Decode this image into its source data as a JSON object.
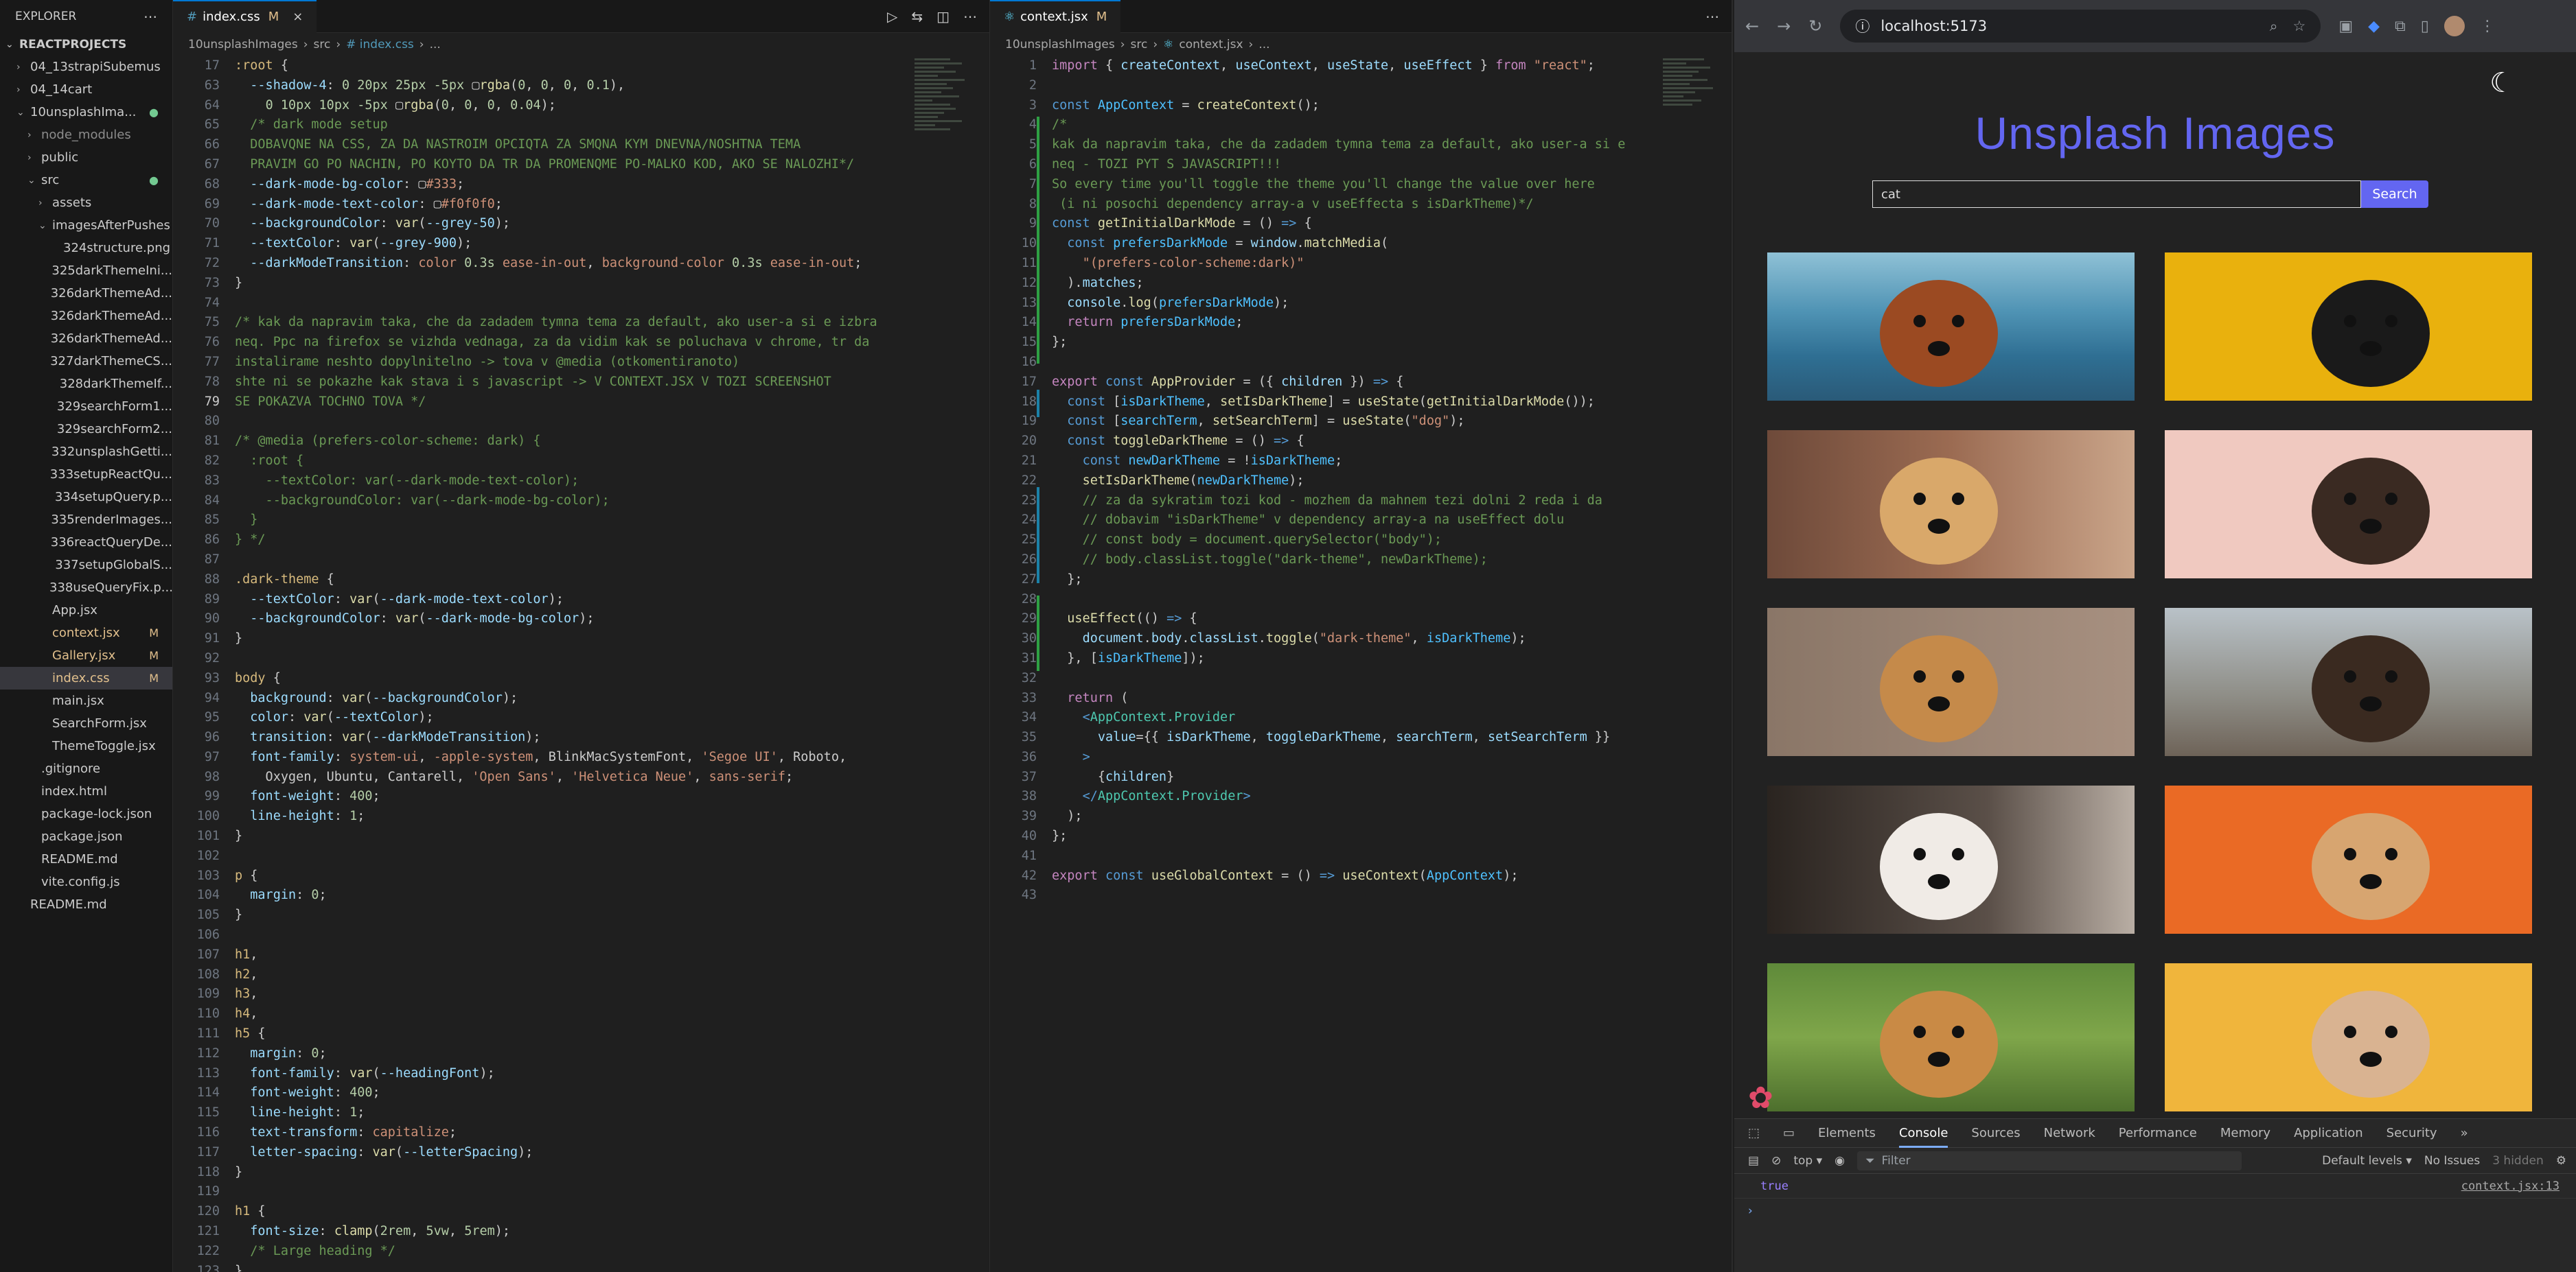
{
  "explorer": {
    "title": "EXPLORER",
    "project": "REACTPROJECTS",
    "items": [
      {
        "label": "04_13strapiSubemus",
        "indent": 1,
        "twisty": "›"
      },
      {
        "label": "04_14cart",
        "indent": 1,
        "twisty": "›"
      },
      {
        "label": "10unsplashIma...",
        "indent": 1,
        "twisty": "⌄",
        "badge": "●"
      },
      {
        "label": "node_modules",
        "indent": 2,
        "twisty": "›",
        "dim": true
      },
      {
        "label": "public",
        "indent": 2,
        "twisty": "›"
      },
      {
        "label": "src",
        "indent": 2,
        "twisty": "⌄",
        "badge": "●"
      },
      {
        "label": "assets",
        "indent": 3,
        "twisty": "›"
      },
      {
        "label": "imagesAfterPushes",
        "indent": 3,
        "twisty": "⌄"
      },
      {
        "label": "324structure.png",
        "indent": 4
      },
      {
        "label": "325darkThemeIni...",
        "indent": 4
      },
      {
        "label": "326darkThemeAd...",
        "indent": 4
      },
      {
        "label": "326darkThemeAd...",
        "indent": 4
      },
      {
        "label": "326darkThemeAd...",
        "indent": 4
      },
      {
        "label": "327darkThemeCS...",
        "indent": 4
      },
      {
        "label": "328darkThemeIf...",
        "indent": 4
      },
      {
        "label": "329searchForm1...",
        "indent": 4
      },
      {
        "label": "329searchForm2...",
        "indent": 4
      },
      {
        "label": "332unsplashGetti...",
        "indent": 4
      },
      {
        "label": "333setupReactQu...",
        "indent": 4
      },
      {
        "label": "334setupQuery.p...",
        "indent": 4
      },
      {
        "label": "335renderImages...",
        "indent": 4
      },
      {
        "label": "336reactQueryDe...",
        "indent": 4
      },
      {
        "label": "337setupGlobalS...",
        "indent": 4
      },
      {
        "label": "338useQueryFix.p...",
        "indent": 4
      },
      {
        "label": "App.jsx",
        "indent": 3
      },
      {
        "label": "context.jsx",
        "indent": 3,
        "badge": "M"
      },
      {
        "label": "Gallery.jsx",
        "indent": 3,
        "badge": "M"
      },
      {
        "label": "index.css",
        "indent": 3,
        "badge": "M",
        "active": true
      },
      {
        "label": "main.jsx",
        "indent": 3
      },
      {
        "label": "SearchForm.jsx",
        "indent": 3
      },
      {
        "label": "ThemeToggle.jsx",
        "indent": 3
      },
      {
        "label": ".gitignore",
        "indent": 2
      },
      {
        "label": "index.html",
        "indent": 2
      },
      {
        "label": "package-lock.json",
        "indent": 2
      },
      {
        "label": "package.json",
        "indent": 2
      },
      {
        "label": "README.md",
        "indent": 2
      },
      {
        "label": "vite.config.js",
        "indent": 2
      },
      {
        "label": "README.md",
        "indent": 1
      }
    ]
  },
  "editor1": {
    "tab": "index.css",
    "tab_status": "M",
    "crumbs": [
      "10unsplashImages",
      "src",
      "# index.css",
      "..."
    ],
    "current_line": 79,
    "lines": [
      {
        "n": 17,
        "h": "<span class='sel'>:root</span> {"
      },
      {
        "n": 63,
        "h": "  <span class='v'>--shadow-4</span>: <span class='n'>0</span> <span class='n'>20px</span> <span class='n'>25px</span> <span class='n'>-5px</span> ▢<span class='f'>rgba</span>(<span class='n'>0</span>, <span class='n'>0</span>, <span class='n'>0</span>, <span class='n'>0.1</span>),"
      },
      {
        "n": 64,
        "h": "    <span class='n'>0</span> <span class='n'>10px</span> <span class='n'>10px</span> <span class='n'>-5px</span> ▢<span class='f'>rgba</span>(<span class='n'>0</span>, <span class='n'>0</span>, <span class='n'>0</span>, <span class='n'>0.04</span>);"
      },
      {
        "n": 65,
        "h": "  <span class='c'>/* dark mode setup</span>"
      },
      {
        "n": 66,
        "h": "<span class='c'>  DOBAVQNE NA CSS, ZA DA NASTROIM OPCIQTA ZA SMQNA KYM DNEVNA/NOSHTNA TEMA</span>"
      },
      {
        "n": 67,
        "h": "<span class='c'>  PRAVIM GO PO NACHIN, PO KOYTO DA TR DA PROMENQME PO-MALKO KOD, AKO SE NALOZHI*/</span>"
      },
      {
        "n": 68,
        "h": "  <span class='v'>--dark-mode-bg-color</span>: ▢<span class='s'>#333</span>;"
      },
      {
        "n": 69,
        "h": "  <span class='v'>--dark-mode-text-color</span>: ▢<span class='s'>#f0f0f0</span>;"
      },
      {
        "n": 70,
        "h": "  <span class='v'>--backgroundColor</span>: <span class='f'>var</span>(<span class='v'>--grey-50</span>);"
      },
      {
        "n": 71,
        "h": "  <span class='v'>--textColor</span>: <span class='f'>var</span>(<span class='v'>--grey-900</span>);"
      },
      {
        "n": 72,
        "h": "  <span class='v'>--darkModeTransition</span>: <span class='s'>color</span> <span class='n'>0.3s</span> <span class='s'>ease-in-out</span>, <span class='s'>background-color</span> <span class='n'>0.3s</span> <span class='s'>ease-in-out</span>;"
      },
      {
        "n": 73,
        "h": "}"
      },
      {
        "n": 74,
        "h": ""
      },
      {
        "n": 75,
        "h": "<span class='c'>/* kak da napravim taka, che da zadadem tymna tema za default, ako user-a si e izbra</span>"
      },
      {
        "n": 76,
        "h": "<span class='c'>neq. Ppc na firefox se vizhda vednaga, za da vidim kak se poluchava v chrome, tr da</span>"
      },
      {
        "n": 77,
        "h": "<span class='c'>instalirame neshto dopylnitelno -> tova v @media (otkomentiranoto)</span>"
      },
      {
        "n": 78,
        "h": "<span class='c'>shte ni se pokazhe kak stava i s javascript -> V CONTEXT.JSX V TOZI SCREENSHOT</span>"
      },
      {
        "n": 79,
        "h": "<span class='c'>SE POKAZVA TOCHNO TOVA */</span>"
      },
      {
        "n": 80,
        "h": ""
      },
      {
        "n": 81,
        "h": "<span class='c'>/* @media (prefers-color-scheme: dark) {</span>"
      },
      {
        "n": 82,
        "h": "<span class='c'>  :root {</span>"
      },
      {
        "n": 83,
        "h": "<span class='c'>    --textColor: var(--dark-mode-text-color);</span>"
      },
      {
        "n": 84,
        "h": "<span class='c'>    --backgroundColor: var(--dark-mode-bg-color);</span>"
      },
      {
        "n": 85,
        "h": "<span class='c'>  }</span>"
      },
      {
        "n": 86,
        "h": "<span class='c'>} */</span>"
      },
      {
        "n": 87,
        "h": ""
      },
      {
        "n": 88,
        "h": "<span class='sel'>.dark-theme</span> {"
      },
      {
        "n": 89,
        "h": "  <span class='v'>--textColor</span>: <span class='f'>var</span>(<span class='v'>--dark-mode-text-color</span>);"
      },
      {
        "n": 90,
        "h": "  <span class='v'>--backgroundColor</span>: <span class='f'>var</span>(<span class='v'>--dark-mode-bg-color</span>);"
      },
      {
        "n": 91,
        "h": "}"
      },
      {
        "n": 92,
        "h": ""
      },
      {
        "n": 93,
        "h": "<span class='sel'>body</span> {"
      },
      {
        "n": 94,
        "h": "  <span class='v'>background</span>: <span class='f'>var</span>(<span class='v'>--backgroundColor</span>);"
      },
      {
        "n": 95,
        "h": "  <span class='v'>color</span>: <span class='f'>var</span>(<span class='v'>--textColor</span>);"
      },
      {
        "n": 96,
        "h": "  <span class='v'>transition</span>: <span class='f'>var</span>(<span class='v'>--darkModeTransition</span>);"
      },
      {
        "n": 97,
        "h": "  <span class='v'>font-family</span>: <span class='s'>system-ui</span>, <span class='s'>-apple-system</span>, BlinkMacSystemFont, <span class='s'>'Segoe UI'</span>, Roboto,"
      },
      {
        "n": 98,
        "h": "    Oxygen, Ubuntu, Cantarell, <span class='s'>'Open Sans'</span>, <span class='s'>'Helvetica Neue'</span>, <span class='s'>sans-serif</span>;"
      },
      {
        "n": 99,
        "h": "  <span class='v'>font-weight</span>: <span class='n'>400</span>;"
      },
      {
        "n": 100,
        "h": "  <span class='v'>line-height</span>: <span class='n'>1</span>;"
      },
      {
        "n": 101,
        "h": "}"
      },
      {
        "n": 102,
        "h": ""
      },
      {
        "n": 103,
        "h": "<span class='sel'>p</span> {"
      },
      {
        "n": 104,
        "h": "  <span class='v'>margin</span>: <span class='n'>0</span>;"
      },
      {
        "n": 105,
        "h": "}"
      },
      {
        "n": 106,
        "h": ""
      },
      {
        "n": 107,
        "h": "<span class='sel'>h1</span>,"
      },
      {
        "n": 108,
        "h": "<span class='sel'>h2</span>,"
      },
      {
        "n": 109,
        "h": "<span class='sel'>h3</span>,"
      },
      {
        "n": 110,
        "h": "<span class='sel'>h4</span>,"
      },
      {
        "n": 111,
        "h": "<span class='sel'>h5</span> {"
      },
      {
        "n": 112,
        "h": "  <span class='v'>margin</span>: <span class='n'>0</span>;"
      },
      {
        "n": 113,
        "h": "  <span class='v'>font-family</span>: <span class='f'>var</span>(<span class='v'>--headingFont</span>);"
      },
      {
        "n": 114,
        "h": "  <span class='v'>font-weight</span>: <span class='n'>400</span>;"
      },
      {
        "n": 115,
        "h": "  <span class='v'>line-height</span>: <span class='n'>1</span>;"
      },
      {
        "n": 116,
        "h": "  <span class='v'>text-transform</span>: <span class='s'>capitalize</span>;"
      },
      {
        "n": 117,
        "h": "  <span class='v'>letter-spacing</span>: <span class='f'>var</span>(<span class='v'>--letterSpacing</span>);"
      },
      {
        "n": 118,
        "h": "}"
      },
      {
        "n": 119,
        "h": ""
      },
      {
        "n": 120,
        "h": "<span class='sel'>h1</span> {"
      },
      {
        "n": 121,
        "h": "  <span class='v'>font-size</span>: <span class='f'>clamp</span>(<span class='n'>2rem</span>, <span class='n'>5vw</span>, <span class='n'>5rem</span>);"
      },
      {
        "n": 122,
        "h": "  <span class='c'>/* Large heading */</span>"
      },
      {
        "n": 123,
        "h": "}"
      }
    ]
  },
  "editor2": {
    "tab": "context.jsx",
    "tab_status": "M",
    "crumbs": [
      "10unsplashImages",
      "src",
      "context.jsx",
      "..."
    ],
    "lines": [
      {
        "n": 1,
        "h": "<span class='k'>import</span> { <span class='v'>createContext</span>, <span class='v'>useContext</span>, <span class='v'>useState</span>, <span class='v'>useEffect</span> } <span class='k'>from</span> <span class='s'>\"react\"</span>;"
      },
      {
        "n": 2,
        "h": ""
      },
      {
        "n": 3,
        "h": "<span class='b'>const</span> <span class='cst'>AppContext</span> = <span class='f'>createContext</span>();"
      },
      {
        "n": 4,
        "h": "<span class='c'>/*</span>"
      },
      {
        "n": 5,
        "h": "<span class='c'>kak da napravim taka, che da zadadem tymna tema za default, ako user-a si e</span>"
      },
      {
        "n": 6,
        "h": "<span class='c'>neq - TOZI PYT S JAVASCRIPT!!!</span>"
      },
      {
        "n": 7,
        "h": "<span class='c'>So every time you'll toggle the theme you'll change the value over here</span>"
      },
      {
        "n": 8,
        "h": "<span class='c'> (i ni posochi dependency array-a v useEffecta s isDarkTheme)*/</span>"
      },
      {
        "n": 9,
        "h": "<span class='b'>const</span> <span class='f'>getInitialDarkMode</span> = () <span class='b'>=&gt;</span> {"
      },
      {
        "n": 10,
        "h": "  <span class='b'>const</span> <span class='cst'>prefersDarkMode</span> = <span class='v'>window</span>.<span class='f'>matchMedia</span>("
      },
      {
        "n": 11,
        "h": "    <span class='s'>\"(prefers-color-scheme:dark)\"</span>"
      },
      {
        "n": 12,
        "h": "  ).<span class='v'>matches</span>;"
      },
      {
        "n": 13,
        "h": "  <span class='v'>console</span>.<span class='f'>log</span>(<span class='cst'>prefersDarkMode</span>);"
      },
      {
        "n": 14,
        "h": "  <span class='k'>return</span> <span class='cst'>prefersDarkMode</span>;"
      },
      {
        "n": 15,
        "h": "};"
      },
      {
        "n": 16,
        "h": ""
      },
      {
        "n": 17,
        "h": "<span class='k'>export</span> <span class='b'>const</span> <span class='f'>AppProvider</span> = ({ <span class='v'>children</span> }) <span class='b'>=&gt;</span> {"
      },
      {
        "n": 18,
        "h": "  <span class='b'>const</span> [<span class='cst'>isDarkTheme</span>, <span class='f'>setIsDarkTheme</span>] = <span class='f'>useState</span>(<span class='f'>getInitialDarkMode</span>());"
      },
      {
        "n": 19,
        "h": "  <span class='b'>const</span> [<span class='cst'>searchTerm</span>, <span class='f'>setSearchTerm</span>] = <span class='f'>useState</span>(<span class='s'>\"dog\"</span>);"
      },
      {
        "n": 20,
        "h": "  <span class='b'>const</span> <span class='f'>toggleDarkTheme</span> = () <span class='b'>=&gt;</span> {"
      },
      {
        "n": 21,
        "h": "    <span class='b'>const</span> <span class='cst'>newDarkTheme</span> = !<span class='cst'>isDarkTheme</span>;"
      },
      {
        "n": 22,
        "h": "    <span class='f'>setIsDarkTheme</span>(<span class='cst'>newDarkTheme</span>);"
      },
      {
        "n": 23,
        "h": "    <span class='c'>// za da sykratim tozi kod - mozhem da mahnem tezi dolni 2 reda i da</span>"
      },
      {
        "n": 24,
        "h": "    <span class='c'>// dobavim \"isDarkTheme\" v dependency array-a na useEffect dolu</span>"
      },
      {
        "n": 25,
        "h": "    <span class='c'>// const body = document.querySelector(\"body\");</span>"
      },
      {
        "n": 26,
        "h": "    <span class='c'>// body.classList.toggle(\"dark-theme\", newDarkTheme);</span>"
      },
      {
        "n": 27,
        "h": "  };"
      },
      {
        "n": 28,
        "h": ""
      },
      {
        "n": 29,
        "h": "  <span class='f'>useEffect</span>(() <span class='b'>=&gt;</span> {"
      },
      {
        "n": 30,
        "h": "    <span class='v'>document</span>.<span class='v'>body</span>.<span class='v'>classList</span>.<span class='f'>toggle</span>(<span class='s'>\"dark-theme\"</span>, <span class='cst'>isDarkTheme</span>);"
      },
      {
        "n": 31,
        "h": "  }, [<span class='cst'>isDarkTheme</span>]);"
      },
      {
        "n": 32,
        "h": ""
      },
      {
        "n": 33,
        "h": "  <span class='k'>return</span> ("
      },
      {
        "n": 34,
        "h": "    <span class='b'>&lt;</span><span class='t'>AppContext.Provider</span>"
      },
      {
        "n": 35,
        "h": "      <span class='v'>value</span>={{ <span class='v'>isDarkTheme</span>, <span class='v'>toggleDarkTheme</span>, <span class='v'>searchTerm</span>, <span class='v'>setSearchTerm</span> }}"
      },
      {
        "n": 36,
        "h": "    <span class='b'>&gt;</span>"
      },
      {
        "n": 37,
        "h": "      {<span class='v'>children</span>}"
      },
      {
        "n": 38,
        "h": "    <span class='b'>&lt;/</span><span class='t'>AppContext.Provider</span><span class='b'>&gt;</span>"
      },
      {
        "n": 39,
        "h": "  );"
      },
      {
        "n": 40,
        "h": "};"
      },
      {
        "n": 41,
        "h": ""
      },
      {
        "n": 42,
        "h": "<span class='k'>export</span> <span class='b'>const</span> <span class='f'>useGlobalContext</span> = () <span class='b'>=&gt;</span> <span class='f'>useContext</span>(<span class='cst'>AppContext</span>);"
      },
      {
        "n": 43,
        "h": ""
      }
    ]
  },
  "browser": {
    "url": "localhost:5173",
    "page_title": "Unsplash Images",
    "search_value": "cat",
    "search_button": "Search",
    "images": [
      {
        "name": "dog-at-sea",
        "bg": "linear-gradient(180deg,#8fc1d6 0%,#4f93b4 40%,#2f6f93 70%,#2a5a78 100%)",
        "fg": "#9b4a22"
      },
      {
        "name": "black-pug",
        "bg": "#e9b10d",
        "fg": "#1a1a1a"
      },
      {
        "name": "dog-with-flower",
        "bg": "linear-gradient(90deg,#6e4a3a,#9b6b52 50%,#caa58a)",
        "fg": "#d9a86a"
      },
      {
        "name": "terrier-pink",
        "bg": "#f0c9c0",
        "fg": "#3a2a22"
      },
      {
        "name": "happy-beagle",
        "bg": "linear-gradient(90deg,#8a7667,#a79080)",
        "fg": "#c58a4a"
      },
      {
        "name": "collie-field",
        "bg": "linear-gradient(180deg,#b9c2c8,#8e8d86 60%,#6e6358)",
        "fg": "#3a2a20"
      },
      {
        "name": "dog-blue-collar",
        "bg": "linear-gradient(90deg,#2a2420,#5a4f48 60%,#b9aea4)",
        "fg": "#f0ebe6"
      },
      {
        "name": "chihuahua-orange",
        "bg": "#ea6a25",
        "fg": "#d7a570"
      },
      {
        "name": "dog-in-grass",
        "bg": "linear-gradient(180deg,#5f8a3a,#7fa64a 50%,#4d6f2d)",
        "fg": "#c98a45"
      },
      {
        "name": "bulldog-yellow",
        "bg": "#f0b53c",
        "fg": "#d9b391"
      }
    ],
    "devtools": {
      "tabs": [
        "Elements",
        "Console",
        "Sources",
        "Network",
        "Performance",
        "Memory",
        "Application",
        "Security"
      ],
      "active_tab": "Console",
      "context": "top",
      "filter_placeholder": "Filter",
      "levels": "Default levels",
      "issues": "No Issues",
      "hidden": "3 hidden",
      "log_value": "true",
      "log_source": "context.jsx:13"
    }
  }
}
